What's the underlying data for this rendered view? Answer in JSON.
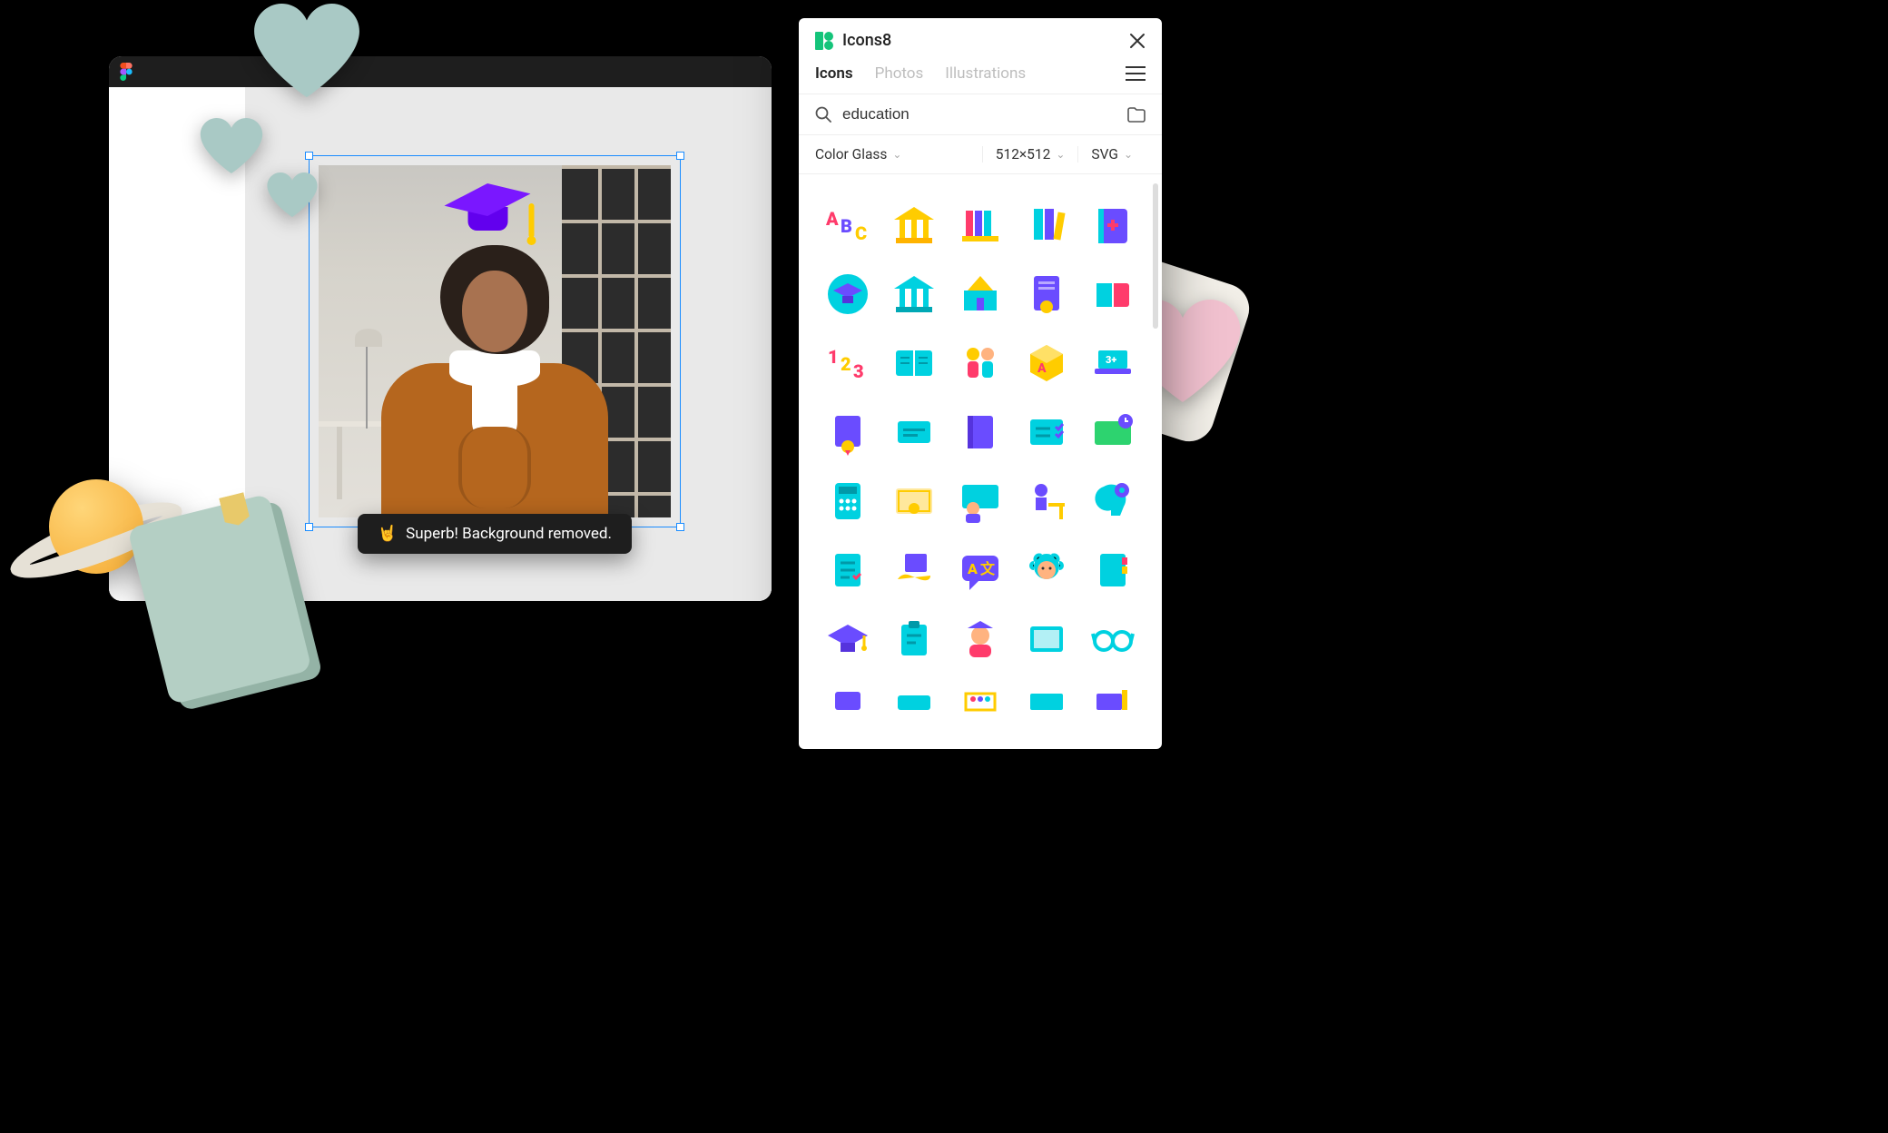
{
  "panel": {
    "brand": "Icons8",
    "tabs": [
      "Icons",
      "Photos",
      "Illustrations"
    ],
    "active_tab": "Icons",
    "search_value": "education",
    "style_filter": "Color Glass",
    "size_filter": "512×512",
    "format_filter": "SVG",
    "icons": [
      "abc-icon",
      "bank-icon",
      "books-shelf-icon",
      "books-stack-icon",
      "notebook-plus-icon",
      "graduation-cap-circle-icon",
      "university-icon",
      "school-building-icon",
      "diploma-icon",
      "open-book-icon",
      "numbers-123-icon",
      "open-textbook-icon",
      "children-icon",
      "abc-block-icon",
      "laptop-learning-icon",
      "book-ribbon-icon",
      "card-horizontal-icon",
      "book-closed-icon",
      "checklist-icon",
      "board-clock-icon",
      "calculator-icon",
      "certificate-icon",
      "teacher-icon",
      "student-desk-icon",
      "brain-gear-icon",
      "task-list-icon",
      "hand-book-icon",
      "language-chat-icon",
      "einstein-icon",
      "notebook-tabs-icon",
      "graduation-cap-icon",
      "clipboard-icon",
      "student-grad-icon",
      "tablet-icon",
      "glasses-icon",
      "book-purple-icon",
      "folder-icon",
      "abacus-icon",
      "board-icon",
      "pencil-book-icon"
    ]
  },
  "toast": {
    "emoji": "🤘",
    "text": "Superb! Background removed."
  },
  "canvas": {
    "overlay_icon": "graduation-cap-icon"
  }
}
